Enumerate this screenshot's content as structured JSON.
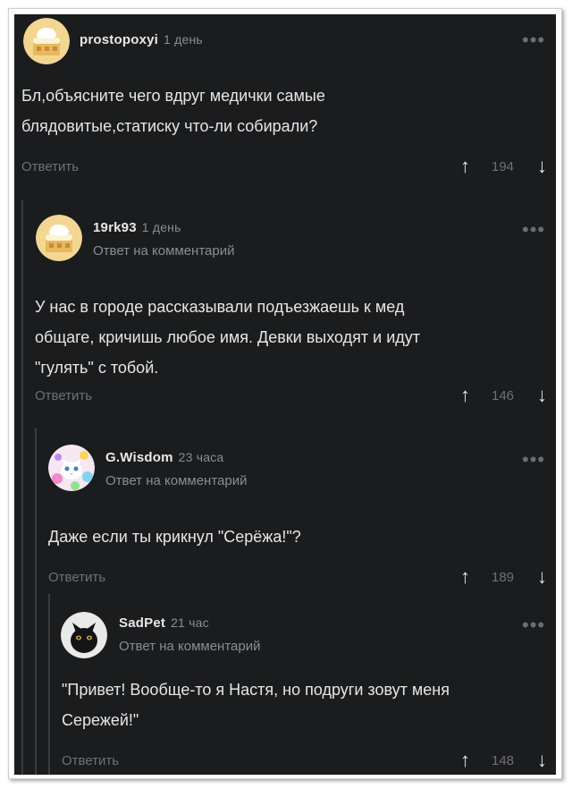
{
  "comments": [
    {
      "username": "prostopoxyi",
      "time": "1 день",
      "reply_to": "",
      "text_lines": [
        "Бл,объясните чего вдруг медички самые",
        "блядовитые,статиску что-ли собирали?"
      ],
      "reply_label": "Ответить",
      "rating": "194",
      "avatar_icon": "cake-icon"
    },
    {
      "username": "19rk93",
      "time": "1 день",
      "reply_to": "Ответ на комментарий",
      "text_lines": [
        "У нас в городе рассказывали подъезжаешь к мед",
        "общаге, кричишь любое имя. Девки выходят и идут",
        "\"гулять\" с тобой."
      ],
      "reply_label": "Ответить",
      "rating": "146",
      "avatar_icon": "cake-icon"
    },
    {
      "username": "G.Wisdom",
      "time": "23 часа",
      "reply_to": "Ответ на комментарий",
      "text_lines": [
        "Даже если ты крикнул \"Серёжа!\"?"
      ],
      "reply_label": "Ответить",
      "rating": "189",
      "avatar_icon": "kitten-icon"
    },
    {
      "username": "SadPet",
      "time": "21 час",
      "reply_to": "Ответ на комментарий",
      "text_lines": [
        "\"Привет! Вообще-то я Настя, но подруги зовут меня",
        "Сережей!\""
      ],
      "reply_label": "Ответить",
      "rating": "148",
      "avatar_icon": "black-cat-icon"
    }
  ],
  "icons": {
    "more": "more-dots-icon",
    "upvote": "arrow-up-icon",
    "downvote": "arrow-down-icon"
  },
  "colors": {
    "background": "#1b1c1e",
    "text": "#e6e6e6",
    "muted": "#8b8d90",
    "thread_line": "#3a3c3f"
  }
}
